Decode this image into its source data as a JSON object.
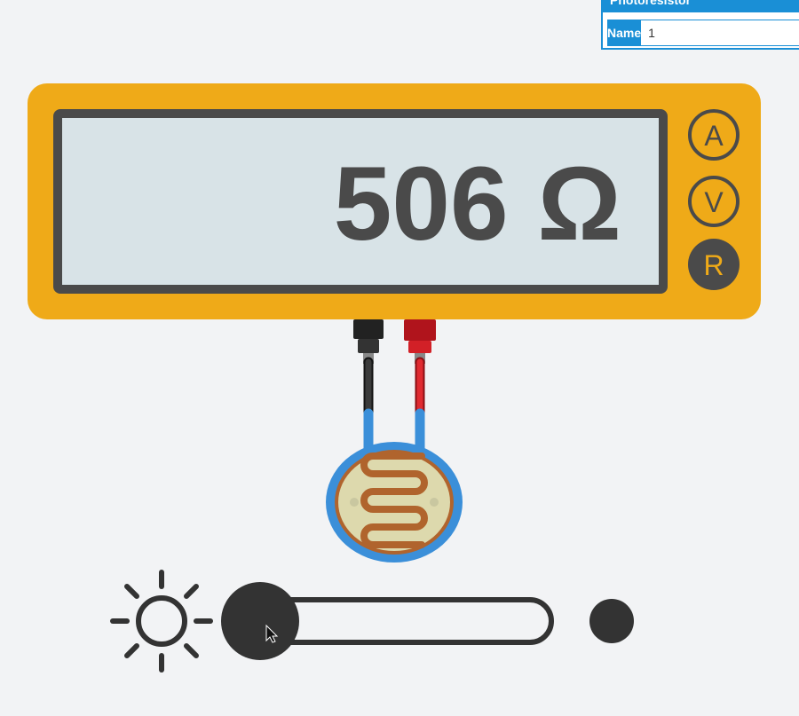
{
  "properties_panel": {
    "title": "Photoresistor",
    "name_label": "Name",
    "name_value": "1"
  },
  "multimeter": {
    "reading": "506 Ω",
    "modes": [
      {
        "label": "A",
        "active": false
      },
      {
        "label": "V",
        "active": false
      },
      {
        "label": "R",
        "active": true
      }
    ],
    "colors": {
      "body": "#efaa18",
      "display": "#d8e3e7",
      "frame": "#4a4a4a"
    }
  },
  "probes": {
    "black": "#333333",
    "red": "#d22027"
  },
  "photoresistor": {
    "colors": {
      "ring": "#3b8fd9",
      "face": "#ddd9ad",
      "track": "#b0642d"
    }
  },
  "light_slider": {
    "level": 0,
    "left_icon": "sun-icon",
    "right_icon": "dark-icon"
  }
}
